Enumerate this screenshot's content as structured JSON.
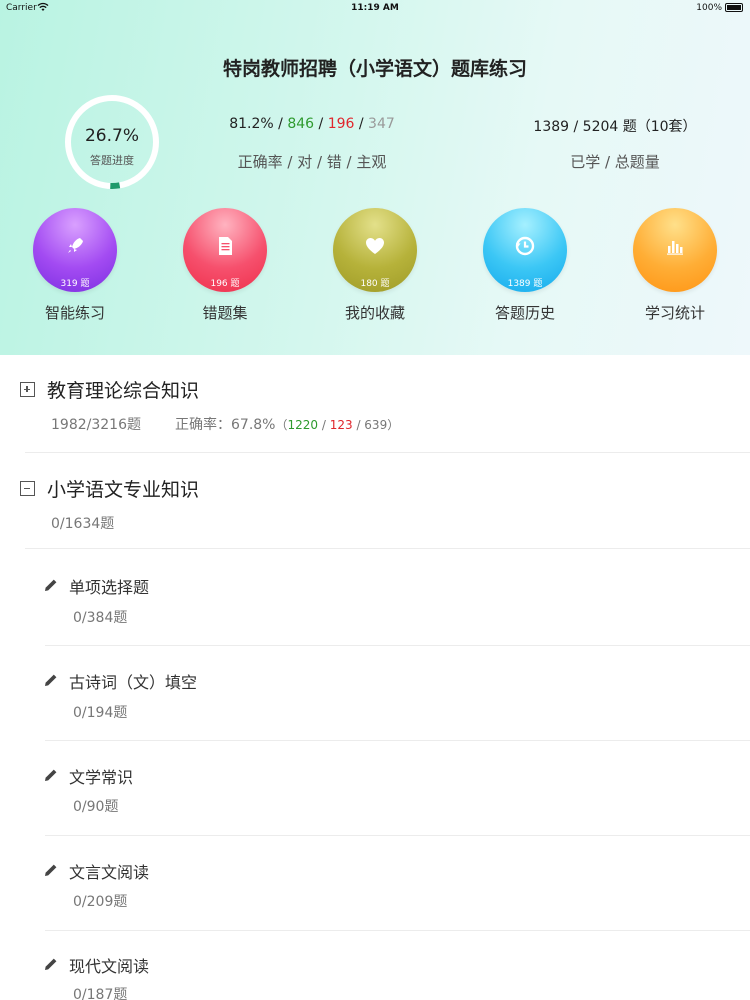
{
  "status_bar": {
    "carrier": "Carrier",
    "time": "11:19 AM",
    "battery": "100%"
  },
  "header": {
    "title": "特岗教师招聘（小学语文）题库练习",
    "progress_value": "26.7%",
    "progress_label": "答题进度",
    "progress_fraction": 0.267,
    "accuracy": "81.2%",
    "correct": "846",
    "wrong": "196",
    "subjective": "347",
    "stats_label": "正确率 / 对 / 错 / 主观",
    "learned_line": "1389 / 5204 题（10套）",
    "learned_label": "已学 / 总题量"
  },
  "shortcuts": [
    {
      "label": "智能练习",
      "count": "319 题",
      "icon": "rocket-icon"
    },
    {
      "label": "错题集",
      "count": "196 题",
      "icon": "document-icon"
    },
    {
      "label": "我的收藏",
      "count": "180 题",
      "icon": "heart-icon"
    },
    {
      "label": "答题历史",
      "count": "1389 题",
      "icon": "history-icon"
    },
    {
      "label": "学习统计",
      "count": "",
      "icon": "bar-chart-icon"
    }
  ],
  "sections": [
    {
      "title": "教育理论综合知识",
      "progress": "1982/3216题",
      "rate_label": "正确率：67.8%",
      "rate_correct": "1220",
      "rate_wrong": "123",
      "rate_subjective": "639",
      "expanded": false
    },
    {
      "title": "小学语文专业知识",
      "progress": "0/1634题",
      "expanded": true,
      "items": [
        {
          "title": "单项选择题",
          "progress": "0/384题"
        },
        {
          "title": "古诗词（文）填空",
          "progress": "0/194题"
        },
        {
          "title": "文学常识",
          "progress": "0/90题"
        },
        {
          "title": "文言文阅读",
          "progress": "0/209题"
        },
        {
          "title": "现代文阅读",
          "progress": "0/187题"
        }
      ]
    }
  ],
  "colors": {
    "correct_green": "#2e9a2e",
    "wrong_red": "#e0262c",
    "progress_ring": "#1f9a6b"
  }
}
